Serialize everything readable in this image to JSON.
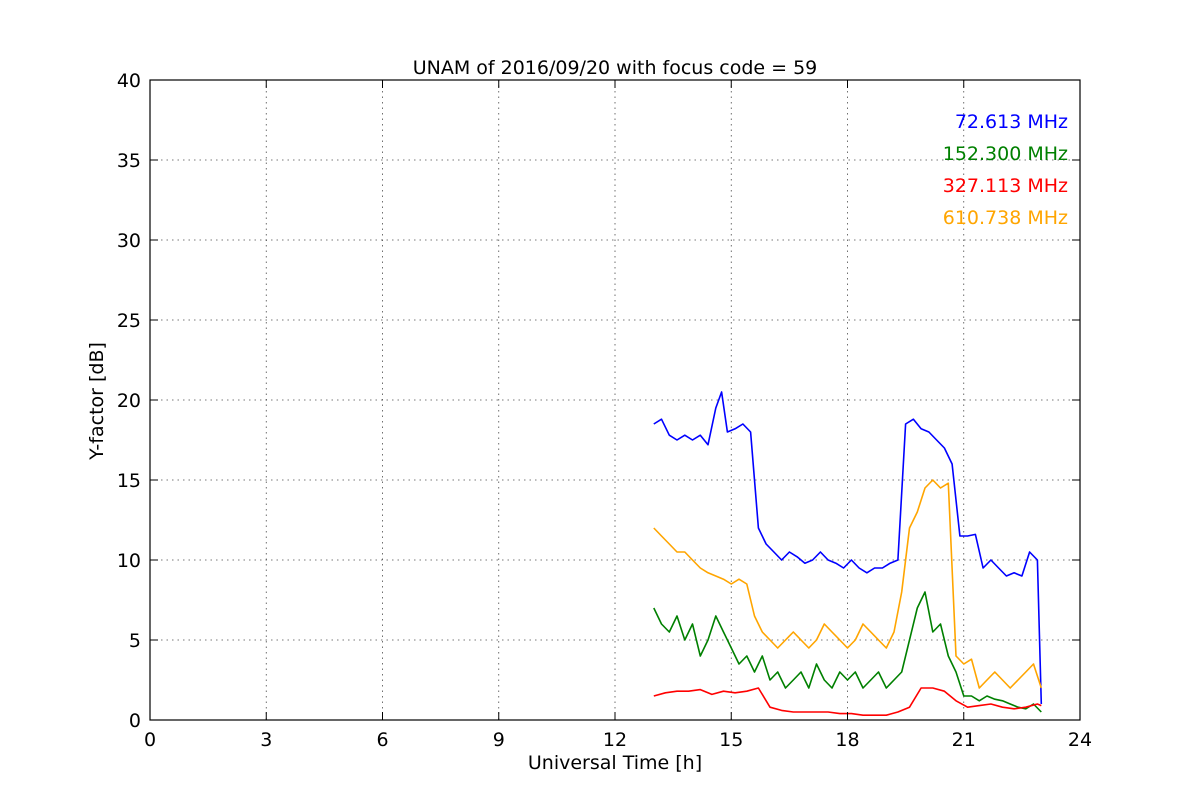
{
  "chart_data": {
    "type": "line",
    "title": "UNAM of 2016/09/20 with focus code = 59",
    "xlabel": "Universal Time [h]",
    "ylabel": "Y-factor [dB]",
    "xlim": [
      0,
      24
    ],
    "ylim": [
      0,
      40
    ],
    "xticks": [
      0,
      3,
      6,
      9,
      12,
      15,
      18,
      21,
      24
    ],
    "yticks": [
      0,
      5,
      10,
      15,
      20,
      25,
      30,
      35,
      40
    ],
    "grid": true,
    "legend_position": "top-right",
    "series": [
      {
        "name": "72.613 MHz",
        "color": "#0000ff",
        "x": [
          13.0,
          13.2,
          13.4,
          13.6,
          13.8,
          14.0,
          14.2,
          14.4,
          14.6,
          14.75,
          14.9,
          15.1,
          15.3,
          15.5,
          15.7,
          15.9,
          16.1,
          16.3,
          16.5,
          16.7,
          16.9,
          17.1,
          17.3,
          17.5,
          17.7,
          17.9,
          18.1,
          18.3,
          18.5,
          18.7,
          18.9,
          19.1,
          19.3,
          19.5,
          19.7,
          19.9,
          20.1,
          20.3,
          20.5,
          20.7,
          20.9,
          21.1,
          21.3,
          21.5,
          21.7,
          21.9,
          22.1,
          22.3,
          22.5,
          22.7,
          22.9,
          23.0
        ],
        "y": [
          18.5,
          18.8,
          17.8,
          17.5,
          17.8,
          17.5,
          17.8,
          17.2,
          19.5,
          20.5,
          18.0,
          18.2,
          18.5,
          18.0,
          12.0,
          11.0,
          10.5,
          10.0,
          10.5,
          10.2,
          9.8,
          10.0,
          10.5,
          10.0,
          9.8,
          9.5,
          10.0,
          9.5,
          9.2,
          9.5,
          9.5,
          9.8,
          10.0,
          18.5,
          18.8,
          18.2,
          18.0,
          17.5,
          17.0,
          16.0,
          11.5,
          11.5,
          11.6,
          9.5,
          10.0,
          9.5,
          9.0,
          9.2,
          9.0,
          10.5,
          10.0,
          1.0
        ]
      },
      {
        "name": "152.300 MHz",
        "color": "#008000",
        "x": [
          13.0,
          13.2,
          13.4,
          13.6,
          13.8,
          14.0,
          14.2,
          14.4,
          14.6,
          14.8,
          15.0,
          15.2,
          15.4,
          15.6,
          15.8,
          16.0,
          16.2,
          16.4,
          16.6,
          16.8,
          17.0,
          17.2,
          17.4,
          17.6,
          17.8,
          18.0,
          18.2,
          18.4,
          18.6,
          18.8,
          19.0,
          19.2,
          19.4,
          19.6,
          19.8,
          20.0,
          20.2,
          20.4,
          20.6,
          20.8,
          21.0,
          21.2,
          21.4,
          21.6,
          21.8,
          22.0,
          22.2,
          22.4,
          22.6,
          22.8,
          23.0
        ],
        "y": [
          7.0,
          6.0,
          5.5,
          6.5,
          5.0,
          6.0,
          4.0,
          5.0,
          6.5,
          5.5,
          4.5,
          3.5,
          4.0,
          3.0,
          4.0,
          2.5,
          3.0,
          2.0,
          2.5,
          3.0,
          2.0,
          3.5,
          2.5,
          2.0,
          3.0,
          2.5,
          3.0,
          2.0,
          2.5,
          3.0,
          2.0,
          2.5,
          3.0,
          5.0,
          7.0,
          8.0,
          5.5,
          6.0,
          4.0,
          3.0,
          1.5,
          1.5,
          1.2,
          1.5,
          1.3,
          1.2,
          1.0,
          0.8,
          0.7,
          1.0,
          0.5
        ]
      },
      {
        "name": "327.113 MHz",
        "color": "#ff0000",
        "x": [
          13.0,
          13.3,
          13.6,
          13.9,
          14.2,
          14.5,
          14.8,
          15.1,
          15.4,
          15.7,
          16.0,
          16.3,
          16.6,
          16.9,
          17.2,
          17.5,
          17.8,
          18.1,
          18.4,
          18.7,
          19.0,
          19.3,
          19.6,
          19.9,
          20.2,
          20.5,
          20.8,
          21.1,
          21.4,
          21.7,
          22.0,
          22.3,
          22.6,
          22.9,
          23.0
        ],
        "y": [
          1.5,
          1.7,
          1.8,
          1.8,
          1.9,
          1.6,
          1.8,
          1.7,
          1.8,
          2.0,
          0.8,
          0.6,
          0.5,
          0.5,
          0.5,
          0.5,
          0.4,
          0.4,
          0.3,
          0.3,
          0.3,
          0.5,
          0.8,
          2.0,
          2.0,
          1.8,
          1.2,
          0.8,
          0.9,
          1.0,
          0.8,
          0.7,
          0.8,
          1.0,
          0.9
        ]
      },
      {
        "name": "610.738 MHz",
        "color": "#ffa500",
        "x": [
          13.0,
          13.2,
          13.4,
          13.6,
          13.8,
          14.0,
          14.2,
          14.4,
          14.6,
          14.8,
          15.0,
          15.2,
          15.4,
          15.6,
          15.8,
          16.0,
          16.2,
          16.4,
          16.6,
          16.8,
          17.0,
          17.2,
          17.4,
          17.6,
          17.8,
          18.0,
          18.2,
          18.4,
          18.6,
          18.8,
          19.0,
          19.2,
          19.4,
          19.6,
          19.8,
          20.0,
          20.2,
          20.4,
          20.6,
          20.8,
          21.0,
          21.2,
          21.4,
          21.6,
          21.8,
          22.0,
          22.2,
          22.4,
          22.6,
          22.8,
          23.0
        ],
        "y": [
          12.0,
          11.5,
          11.0,
          10.5,
          10.5,
          10.0,
          9.5,
          9.2,
          9.0,
          8.8,
          8.5,
          8.8,
          8.5,
          6.5,
          5.5,
          5.0,
          4.5,
          5.0,
          5.5,
          5.0,
          4.5,
          5.0,
          6.0,
          5.5,
          5.0,
          4.5,
          5.0,
          6.0,
          5.5,
          5.0,
          4.5,
          5.5,
          8.0,
          12.0,
          13.0,
          14.5,
          15.0,
          14.5,
          14.8,
          4.0,
          3.5,
          3.8,
          2.0,
          2.5,
          3.0,
          2.5,
          2.0,
          2.5,
          3.0,
          3.5,
          2.0
        ]
      }
    ]
  }
}
